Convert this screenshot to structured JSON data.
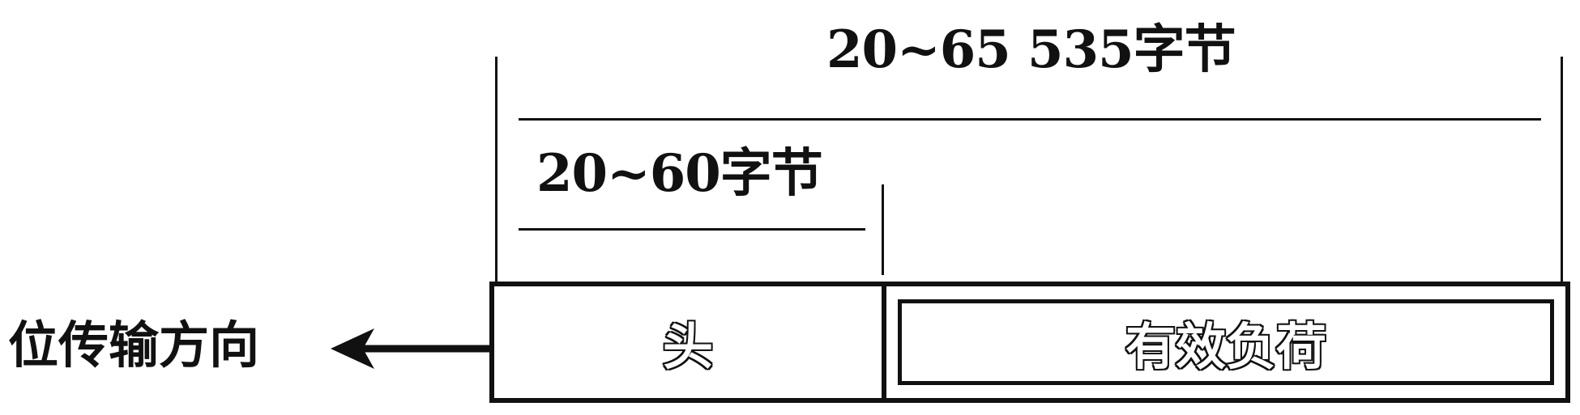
{
  "diagram": {
    "total_length_label": "20~65 535字节",
    "header_length_label": "20~60字节",
    "header_label": "头",
    "payload_label": "有效负荷",
    "direction_label": "位传输方向",
    "direction_arrow": "left-arrow-icon"
  }
}
